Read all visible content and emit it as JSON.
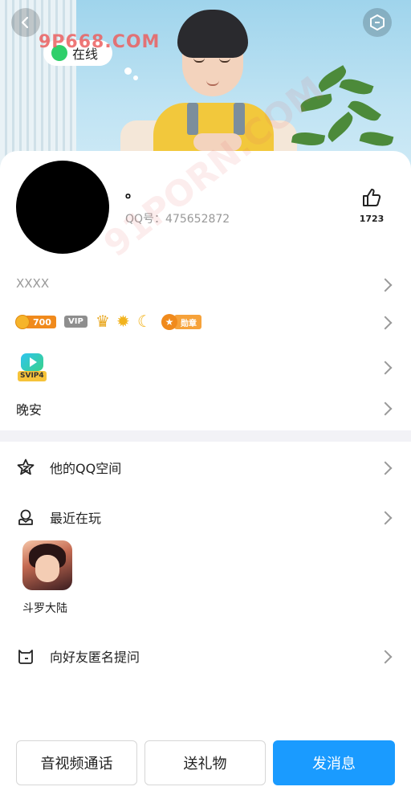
{
  "header": {
    "status_text": "在线"
  },
  "profile": {
    "nickname": "。",
    "qq_number": "QQ号：475652872",
    "likes": "1723",
    "signature_placeholder": "XXXX",
    "status_message": "晚安"
  },
  "badges": {
    "coin": "700",
    "vip": "VIP",
    "medal": "勋章",
    "svip": "SVIP4"
  },
  "menu": {
    "qzone": "他的QQ空间",
    "recent_play": "最近在玩",
    "ask_anonymous": "向好友匿名提问"
  },
  "recent_game": {
    "name": "斗罗大陆"
  },
  "actions": {
    "call": "音视频通话",
    "gift": "送礼物",
    "message": "发消息"
  },
  "watermark": {
    "text": "9P668.COM",
    "text2": "91PORN.COM"
  },
  "colors": {
    "accent": "#1a9bff",
    "online": "#2fcf6a"
  }
}
